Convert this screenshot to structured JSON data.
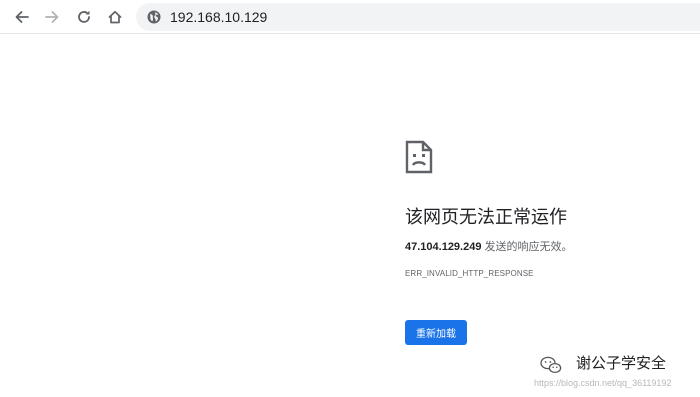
{
  "browser": {
    "address_bar": {
      "url": "192.168.10.129",
      "site_icon": "globe-icon"
    },
    "nav": {
      "back_icon": "arrow-left-icon",
      "forward_icon": "arrow-right-icon",
      "reload_icon": "reload-icon",
      "home_icon": "home-icon"
    }
  },
  "error": {
    "icon": "sad-document-icon",
    "title": "该网页无法正常运作",
    "host": "47.104.129.249",
    "description_suffix": " 发送的响应无效。",
    "code": "ERR_INVALID_HTTP_RESPONSE",
    "reload_label": "重新加载"
  },
  "watermark": {
    "text": "谢公子学安全",
    "url": "https://blog.csdn.net/qq_36119192"
  },
  "colors": {
    "accent": "#1a73e8",
    "omnibox_bg": "#f1f3f4",
    "text_primary": "#202124",
    "text_secondary": "#5f6368"
  }
}
